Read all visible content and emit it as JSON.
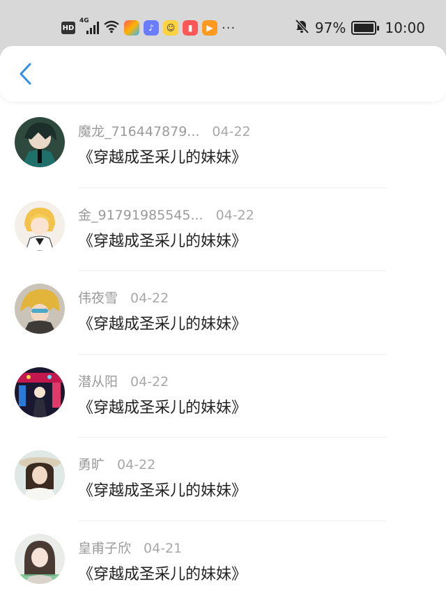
{
  "status_bar": {
    "hd": "HD",
    "network": "4G",
    "battery_text": "97%",
    "battery_level": 0.97,
    "time": "10:00",
    "more": "···",
    "icons": [
      "signal-icon",
      "wifi-icon",
      "app-icon",
      "music-icon",
      "chat-icon",
      "book-icon",
      "video-icon",
      "mute-bell-icon",
      "battery-icon"
    ]
  },
  "nav": {
    "back_icon": "chevron-left-icon",
    "accent": "#2f8fe8"
  },
  "items": [
    {
      "name": "魔龙_716447879...",
      "date": "04-22",
      "title": "《穿越成圣采儿的妹妹》"
    },
    {
      "name": "金_91791985545...",
      "date": "04-22",
      "title": "《穿越成圣采儿的妹妹》"
    },
    {
      "name": "伟夜雪",
      "date": "04-22",
      "title": "《穿越成圣采儿的妹妹》"
    },
    {
      "name": "潜从阳",
      "date": "04-22",
      "title": "《穿越成圣采儿的妹妹》"
    },
    {
      "name": "勇旷",
      "date": "04-22",
      "title": "《穿越成圣采儿的妹妹》"
    },
    {
      "name": "皇甫子欣",
      "date": "04-21",
      "title": "《穿越成圣采儿的妹妹》"
    }
  ]
}
